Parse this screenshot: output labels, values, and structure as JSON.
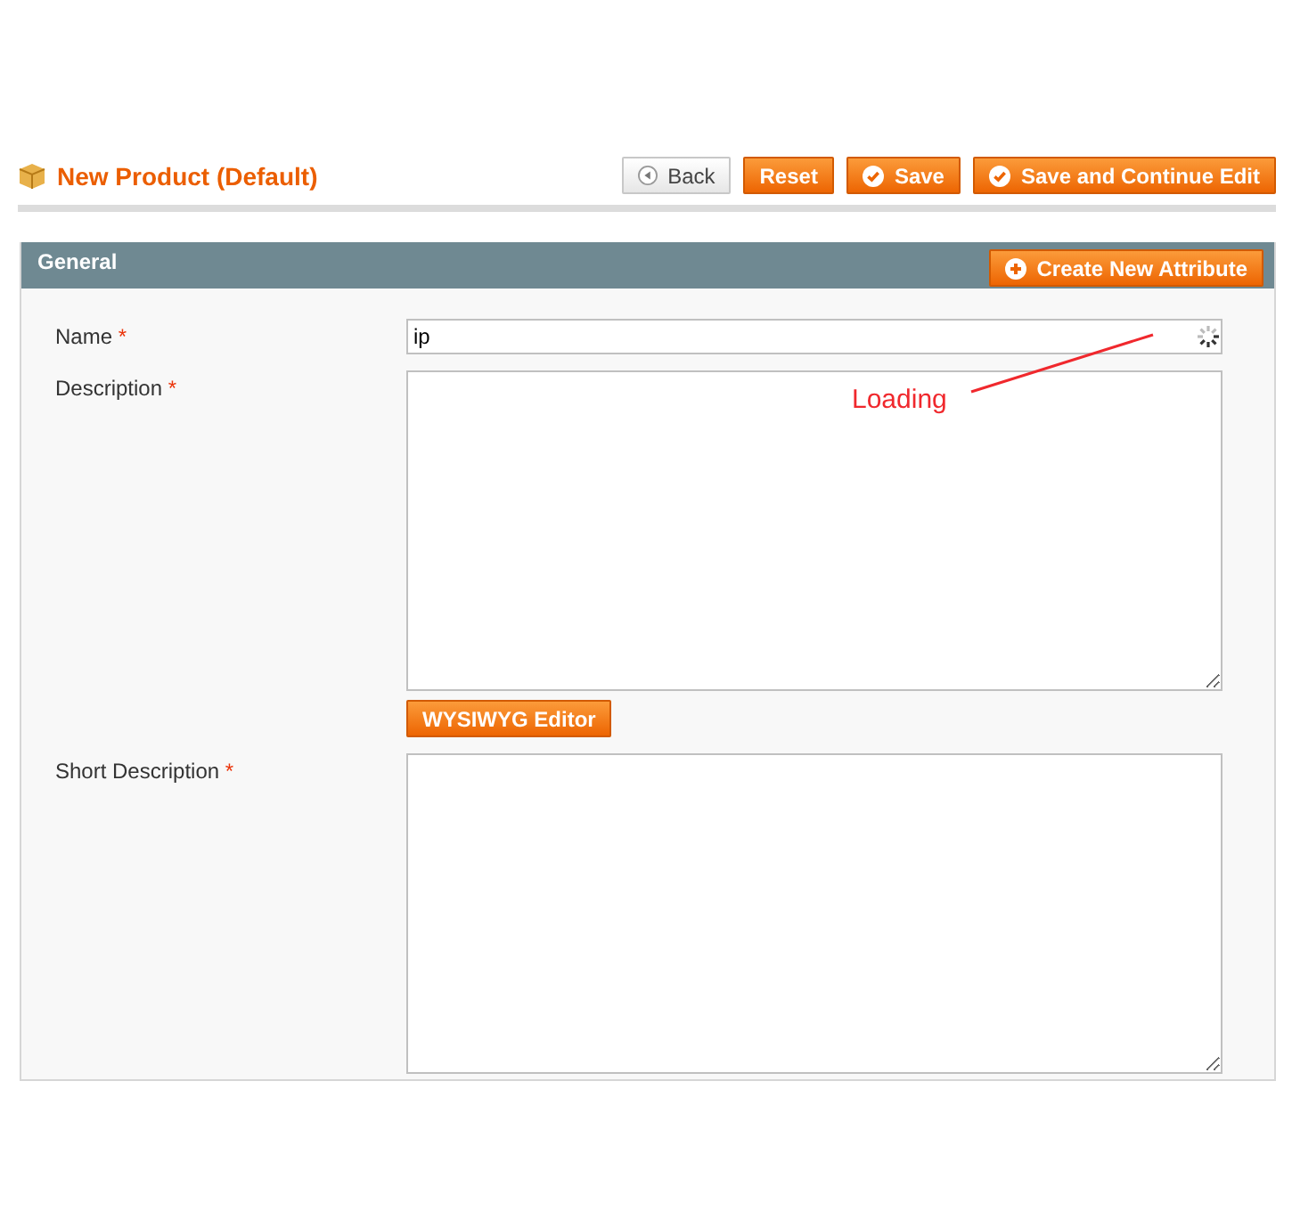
{
  "header": {
    "title": "New Product (Default)"
  },
  "buttons": [
    {
      "label": "Back",
      "kind": "back"
    },
    {
      "label": "Reset",
      "kind": "plain"
    },
    {
      "label": "Save",
      "kind": "confirm"
    },
    {
      "label": "Save and Continue Edit",
      "kind": "confirm"
    }
  ],
  "panel": {
    "title": "General",
    "action": "Create New Attribute"
  },
  "fields": [
    {
      "label": "Name",
      "required_mark": "*",
      "kind": "input",
      "value": "ip",
      "loading": true
    },
    {
      "label": "Description",
      "required_mark": "*",
      "kind": "textarea",
      "editor_button": "WYSIWYG Editor"
    },
    {
      "label": "Short Description",
      "required_mark": "*",
      "kind": "textarea"
    }
  ],
  "annotation": {
    "text": "Loading"
  }
}
